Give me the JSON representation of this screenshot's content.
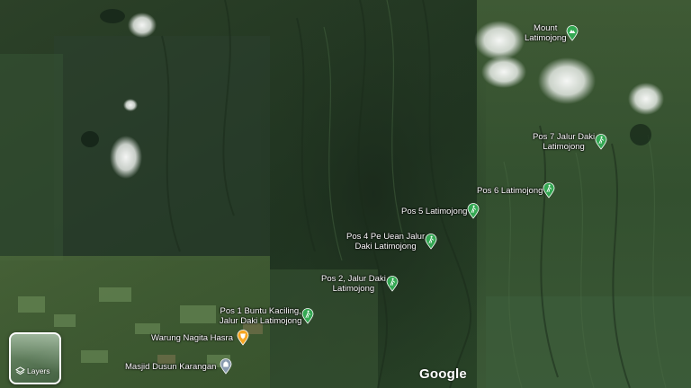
{
  "map": {
    "type": "satellite",
    "branding": "Google"
  },
  "layers": {
    "label": "Layers",
    "icon": "layers-icon"
  },
  "places": {
    "mount": {
      "text": "Mount\nLatimojong",
      "icon": "mountain-icon",
      "color": "#34a853"
    },
    "pos7": {
      "text": "Pos 7 Jalur Daki\nLatimojong",
      "icon": "hiking-icon",
      "color": "#34a853"
    },
    "pos6": {
      "text": "Pos 6 Latimojong",
      "icon": "hiking-icon",
      "color": "#34a853"
    },
    "pos5": {
      "text": "Pos 5 Latimojong",
      "icon": "hiking-icon",
      "color": "#34a853"
    },
    "pos4": {
      "text": "Pos 4 Pe  Uean Jalur\nDaki Latimojong",
      "icon": "hiking-icon",
      "color": "#34a853"
    },
    "pos2": {
      "text": "Pos 2, Jalur Daki\nLatimojong",
      "icon": "hiking-icon",
      "color": "#34a853"
    },
    "pos1": {
      "text": "Pos 1 Buntu Kaciling,\nJalur Daki Latimojong",
      "icon": "hiking-icon",
      "color": "#34a853"
    },
    "warung": {
      "text": "Warung Nagita Hasra",
      "icon": "restaurant-icon",
      "color": "#f5a623"
    },
    "masjid": {
      "text": "Masjid Dusun Karangan",
      "icon": "mosque-icon",
      "color": "#8a9bb0"
    }
  }
}
